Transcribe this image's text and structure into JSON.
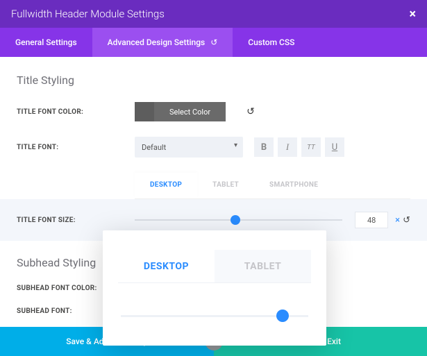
{
  "header": {
    "title": "Fullwidth Header Module Settings",
    "close": "×"
  },
  "tabs": {
    "general": "General Settings",
    "advanced": "Advanced Design Settings",
    "css": "Custom CSS"
  },
  "title_styling": {
    "heading": "Title Styling",
    "font_color_label": "TITLE FONT COLOR:",
    "select_color": "Select Color",
    "font_label": "TITLE FONT:",
    "font_value": "Default",
    "bold": "B",
    "italic": "I",
    "tt": "TT",
    "underline": "U",
    "device_desktop": "DESKTOP",
    "device_tablet": "TABLET",
    "device_phone": "SMARTPHONE",
    "size_label": "TITLE FONT SIZE:",
    "size_value": "48"
  },
  "subhead_styling": {
    "heading": "Subhead Styling",
    "font_color_label": "SUBHEAD FONT COLOR:",
    "font_label": "SUBHEAD FONT:"
  },
  "overlay": {
    "desktop": "DESKTOP",
    "tablet": "TABLET"
  },
  "footer": {
    "add": "Save & Add To Library",
    "exit": "Save & Exit",
    "gear": "⚙"
  },
  "icons": {
    "reset": "↺",
    "close_x": "×"
  }
}
